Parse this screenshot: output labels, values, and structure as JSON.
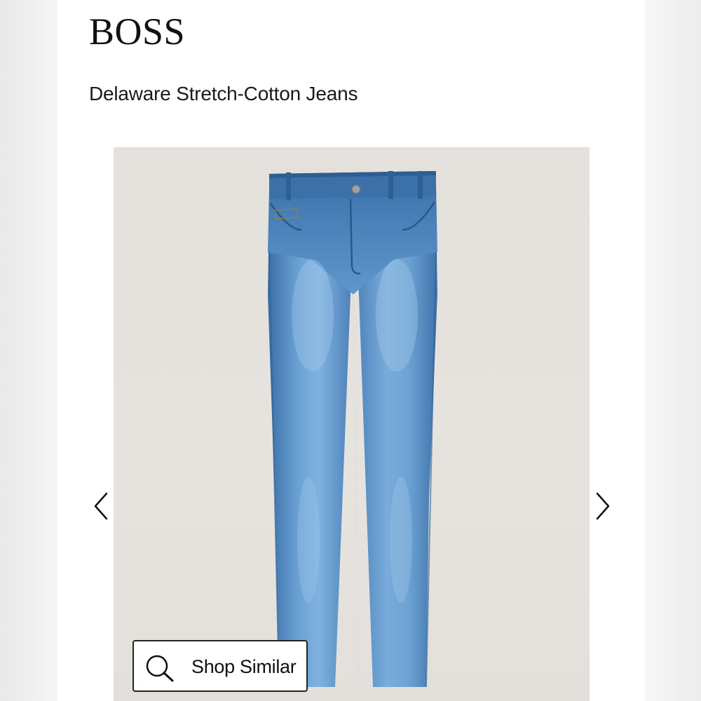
{
  "header": {
    "brand": "BOSS",
    "product_title": "Delaware Stretch-Cotton Jeans"
  },
  "gallery": {
    "image_subject": "light blue straight-leg jeans",
    "prev_icon": "chevron-left-icon",
    "next_icon": "chevron-right-icon"
  },
  "shop_similar": {
    "label": "Shop Similar",
    "icon": "search-icon"
  },
  "colors": {
    "denim": "#4f86bf",
    "denim_light": "#7fb0dc",
    "denim_dark": "#2f5f92",
    "backdrop": "#e5e2dd",
    "text": "#111111"
  }
}
